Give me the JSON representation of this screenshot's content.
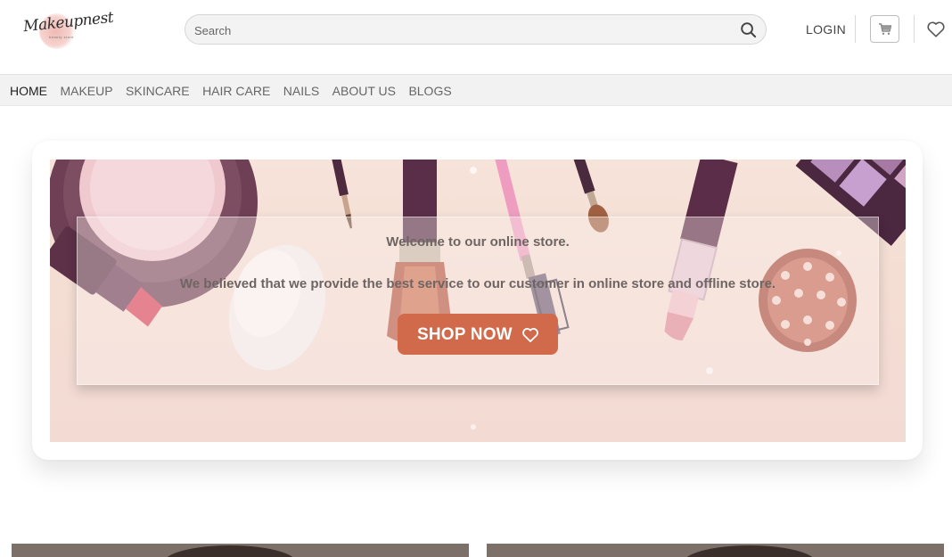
{
  "header": {
    "logo_text": "Makeupnest",
    "logo_tagline": "beauty store",
    "search": {
      "placeholder": "Search"
    },
    "login_label": "LOGIN",
    "icons": {
      "search": "search-icon",
      "cart": "cart-icon",
      "wishlist": "heart-icon"
    }
  },
  "nav": {
    "items": [
      {
        "label": "HOME",
        "active": true
      },
      {
        "label": "MAKEUP"
      },
      {
        "label": "SKINCARE"
      },
      {
        "label": "HAIR CARE"
      },
      {
        "label": "NAILS"
      },
      {
        "label": "ABOUT US"
      },
      {
        "label": "BLOGS"
      }
    ]
  },
  "hero": {
    "welcome": "Welcome to our online store.",
    "tagline": "We believed that we provide the best service to our customer in online store and offline store.",
    "cta_label": "SHOP NOW",
    "cta_icon": "heart-outline-icon"
  },
  "colors": {
    "accent": "#d16a4b",
    "nav_bg": "#f2f2f2",
    "hero_bg": "#f5e1d7",
    "text_muted": "#6e6563"
  }
}
